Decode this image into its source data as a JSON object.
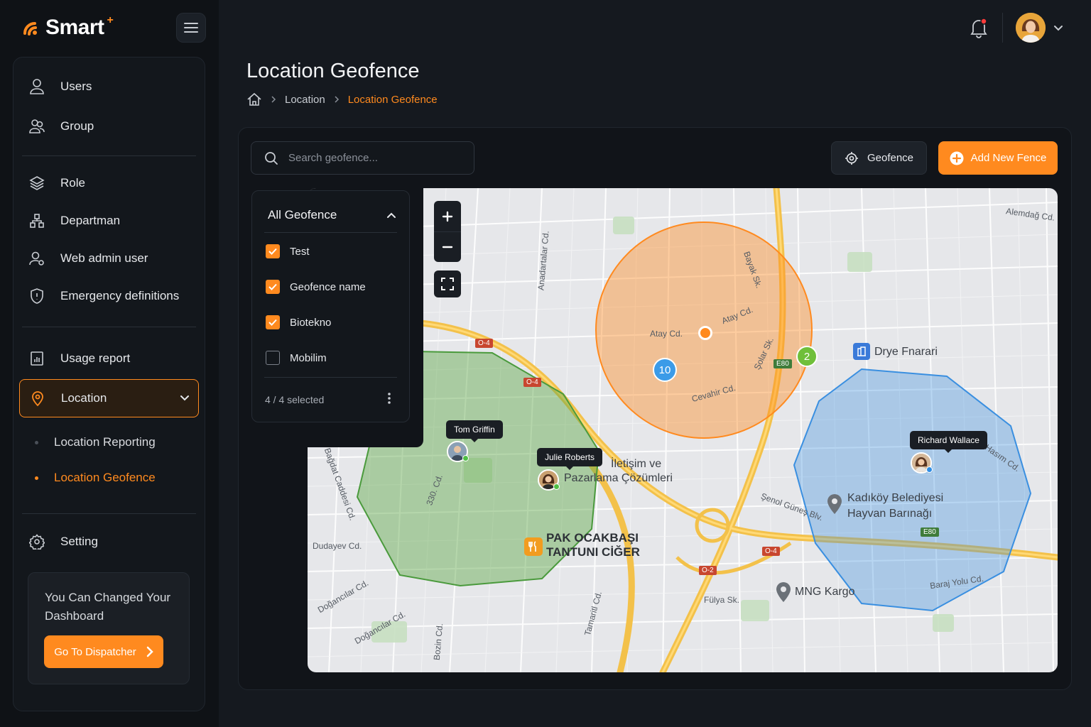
{
  "app": {
    "logo": "Smart",
    "logo_plus": "+"
  },
  "sidebar": {
    "items": [
      {
        "label": "Users",
        "icon": "user-icon"
      },
      {
        "label": "Group",
        "icon": "users-icon"
      },
      {
        "label": "Role",
        "icon": "layers-icon"
      },
      {
        "label": "Departman",
        "icon": "hierarchy-icon"
      },
      {
        "label": "Web admin user",
        "icon": "admin-user-icon"
      },
      {
        "label": "Emergency definitions",
        "icon": "shield-icon"
      },
      {
        "label": "Usage report",
        "icon": "report-icon"
      },
      {
        "label": "Location",
        "icon": "map-pin-icon"
      },
      {
        "label": "Setting",
        "icon": "gear-icon"
      }
    ],
    "sub_items": [
      {
        "label": "Location Reporting",
        "active": false
      },
      {
        "label": "Location Geofence",
        "active": true
      }
    ],
    "promo": {
      "text": "You Can Changed Your Dashboard",
      "button": "Go To Dispatcher"
    }
  },
  "header": {
    "notifications_unread": true
  },
  "page": {
    "title": "Location Geofence",
    "breadcrumb": [
      "Location",
      "Location Geofence"
    ]
  },
  "toolbar": {
    "search_placeholder": "Search geofence...",
    "geofence_button": "Geofence",
    "add_button": "Add New Fence"
  },
  "filter": {
    "title": "All Geofence",
    "options": [
      {
        "label": "Test",
        "checked": true
      },
      {
        "label": "Geofence name",
        "checked": true
      },
      {
        "label": "Biotekno",
        "checked": true
      },
      {
        "label": "Mobilim",
        "checked": false
      }
    ],
    "selected_summary": "4 / 4 selected"
  },
  "map": {
    "users": [
      {
        "name": "Tom Griffin",
        "status_color": "#4fbf45"
      },
      {
        "name": "Julie Roberts",
        "status_color": "#4fbf45"
      },
      {
        "name": "Richard Wallace",
        "status_color": "#2f8de4"
      }
    ],
    "clusters": [
      {
        "count": "10",
        "color": "#3b9be8"
      },
      {
        "count": "2",
        "color": "#6fbf3a"
      }
    ],
    "geofence_colors": {
      "orange": "#ff8a1f",
      "green": "#5fa84a",
      "blue": "#3a8fe0"
    },
    "places": [
      "İletişim ve",
      "Pazarlama Çözümleri",
      "PAK OCAKBAŞI",
      "TANTUNI CİĞER",
      "Kadıköy Belediyesi",
      "Hayvan Barınağı",
      "MNG Kargo",
      "Drye Fnarari"
    ],
    "streets": [
      "Atay Cd.",
      "Atay Cd.",
      "Cevahir Cd.",
      "Bayak Sk.",
      "Şolar Sk.",
      "Dudayev Cd.",
      "Doğancılar Cd.",
      "Doğancılar Cd.",
      "330. Cd.",
      "Fülya Sk.",
      "Baraj Yolu Cd.",
      "Şenol Güneş Blv.",
      "Hasım Cd.",
      "Alemdağ Cd.",
      "Anadartalar Cd.",
      "Bağdat Caddesi Cd.",
      "Bozin Cd.",
      "Tamaritl Cd."
    ],
    "road_badges": [
      "O-4",
      "O-4",
      "O-4",
      "O-2",
      "E80",
      "E80"
    ]
  }
}
